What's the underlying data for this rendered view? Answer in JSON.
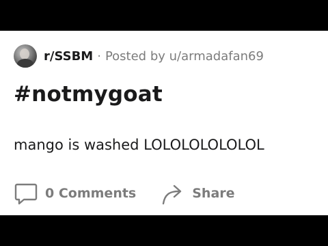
{
  "post": {
    "subreddit": "r/SSBM",
    "separator": "·",
    "posted_by": "Posted by u/armadafan69",
    "title": "#notmygoat",
    "body": "mango is washed LOLOLOLOLOLOL"
  },
  "actions": {
    "comments_label": "0 Comments",
    "share_label": "Share"
  },
  "icons": {
    "comment": "comment-icon",
    "share": "share-icon",
    "avatar": "avatar"
  },
  "colors": {
    "background": "#000000",
    "card": "#ffffff",
    "text": "#1a1a1b",
    "muted": "#7c7c7c"
  }
}
